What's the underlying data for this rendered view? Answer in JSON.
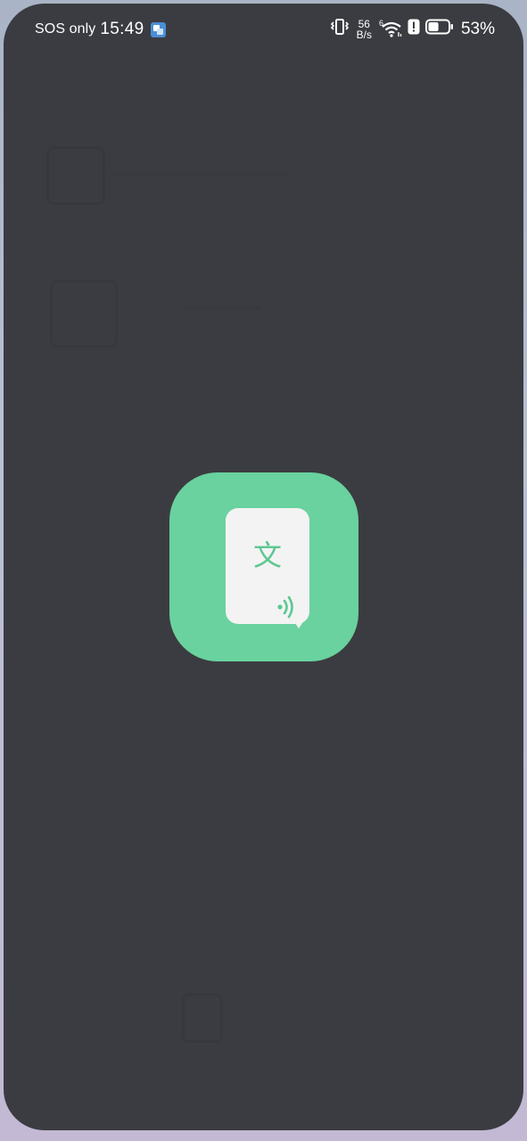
{
  "status_bar": {
    "carrier": "SOS only",
    "time": "15:49",
    "notification_icon": "translate-app-icon",
    "network_speed_value": "56",
    "network_speed_unit": "B/s",
    "wifi_label": "6",
    "battery_percent": "53%",
    "battery_level": 0.53,
    "icons": [
      "vibrate-icon",
      "wifi-icon",
      "alert-icon",
      "battery-icon"
    ]
  },
  "splash": {
    "icon_name": "translate-app-icon",
    "glyph": "文",
    "icon_color": "#69d29e",
    "card_color": "#f3f3f3",
    "glyph_color": "#5cc891"
  },
  "colors": {
    "screen_background": "#3b3c41",
    "status_text": "#ffffff"
  }
}
